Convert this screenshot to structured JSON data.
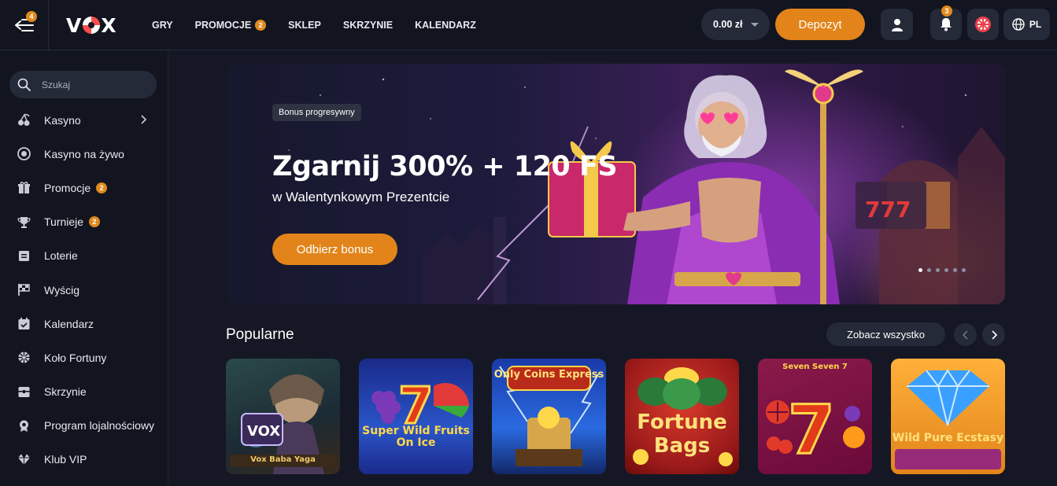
{
  "topbar": {
    "menu_badge": "4",
    "logo": "VOX",
    "nav": [
      {
        "label": "GRY"
      },
      {
        "label": "PROMOCJE",
        "badge": "2"
      },
      {
        "label": "SKLEP"
      },
      {
        "label": "SKRZYNIE"
      },
      {
        "label": "KALENDARZ"
      }
    ],
    "balance": "0.00 zł",
    "deposit_label": "Depozyt",
    "notifications_badge": "3",
    "language": "PL"
  },
  "sidebar": {
    "search_placeholder": "Szukaj",
    "items": [
      {
        "label": "Kasyno",
        "icon": "cherries-icon"
      },
      {
        "label": "Kasyno na żywo",
        "icon": "live-chip-icon"
      },
      {
        "label": "Promocje",
        "icon": "gift-icon",
        "badge": "2"
      },
      {
        "label": "Turnieje",
        "icon": "trophy-icon",
        "badge": "2"
      },
      {
        "label": "Loterie",
        "icon": "ticket-icon"
      },
      {
        "label": "Wyścig",
        "icon": "race-flag-icon"
      },
      {
        "label": "Kalendarz",
        "icon": "calendar-icon"
      },
      {
        "label": "Koło Fortuny",
        "icon": "wheel-icon"
      },
      {
        "label": "Skrzynie",
        "icon": "chest-icon"
      },
      {
        "label": "Program lojalnościowy",
        "icon": "medal-icon"
      },
      {
        "label": "Klub VIP",
        "icon": "diamond-icon"
      }
    ]
  },
  "hero": {
    "tag": "Bonus progresywny",
    "title": "Zgarnij 300% + 120 FS",
    "subtitle": "w Walentynkowym Prezentcie",
    "cta": "Odbierz bonus",
    "slides": 6,
    "active_slide": 1
  },
  "popular": {
    "title": "Popularne",
    "see_all": "Zobacz wszystko",
    "games": [
      {
        "name": "Vox Baba Yaga"
      },
      {
        "name": "Super Wild Fruits On Ice"
      },
      {
        "name": "Only Coins Express"
      },
      {
        "name": "Fortune Bags"
      },
      {
        "name": "Seven Seven 7"
      },
      {
        "name": "Wild Pure Ecstasy"
      }
    ]
  },
  "colors": {
    "accent": "#e2841a",
    "background": "#151824",
    "panel": "#12151f",
    "chip": "#252a38"
  }
}
